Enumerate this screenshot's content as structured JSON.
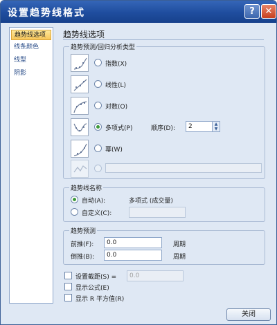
{
  "window": {
    "title": "设置趋势线格式",
    "help_glyph": "?",
    "close_glyph": "✕"
  },
  "nav": {
    "items": [
      {
        "label": "趋势线选项",
        "selected": true
      },
      {
        "label": "线条颜色",
        "selected": false
      },
      {
        "label": "线型",
        "selected": false
      },
      {
        "label": "阴影",
        "selected": false
      }
    ]
  },
  "main": {
    "heading": "趋势线选项",
    "type_group": {
      "label": "趋势预测/回归分析类型",
      "options": [
        {
          "label": "指数(X)",
          "icon": "exponential-trend-icon",
          "checked": false
        },
        {
          "label": "线性(L)",
          "icon": "linear-trend-icon",
          "checked": false
        },
        {
          "label": "对数(O)",
          "icon": "logarithmic-trend-icon",
          "checked": false
        },
        {
          "label": "多项式(P)",
          "icon": "polynomial-trend-icon",
          "checked": true
        },
        {
          "label": "幂(W)",
          "icon": "power-trend-icon",
          "checked": false
        },
        {
          "label": "",
          "icon": "moving-average-trend-icon",
          "checked": false
        }
      ],
      "order_label": "顺序(D):",
      "order_value": "2"
    },
    "name_group": {
      "label": "趋势线名称",
      "auto_label": "自动(A):",
      "auto_value": "多项式 (成交量)",
      "custom_label": "自定义(C):",
      "custom_value": ""
    },
    "forecast_group": {
      "label": "趋势预测",
      "forward_label": "前推(F):",
      "forward_value": "0.0",
      "forward_unit": "周期",
      "backward_label": "倒推(B):",
      "backward_value": "0.0",
      "backward_unit": "周期"
    },
    "options": {
      "intercept_label": "设置截距(S) =",
      "intercept_value": "0.0",
      "show_equation_label": "显示公式(E)",
      "show_r2_label": "显示 R 平方值(R)"
    }
  },
  "footer": {
    "close_label": "关闭"
  },
  "colors": {
    "titlebar": "#1f4d9e",
    "dialog_bg": "#dfe8f4",
    "selected_nav": "#f8c75a",
    "radio_dot": "#3d9a3a"
  }
}
